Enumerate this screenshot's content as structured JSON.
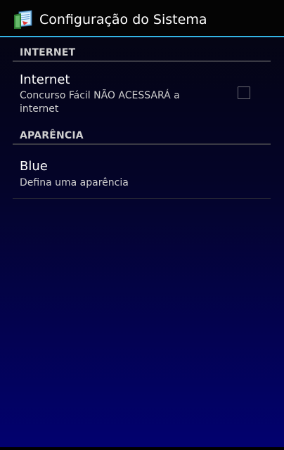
{
  "action_bar": {
    "title": "Configuração do Sistema",
    "icon": "book-app-icon"
  },
  "categories": [
    {
      "label": "INTERNET"
    },
    {
      "label": "APARÊNCIA"
    }
  ],
  "preferences": {
    "internet": {
      "title": "Internet",
      "summary_line1": "Concurso Fácil NÃO ACESSARÁ a",
      "summary_line2": "internet",
      "checked": false
    },
    "appearance": {
      "title": "Blue",
      "summary": "Defina uma aparência"
    }
  },
  "colors": {
    "accent": "#33b5e5",
    "background_top": "#05050f",
    "background_bottom": "#020170"
  }
}
